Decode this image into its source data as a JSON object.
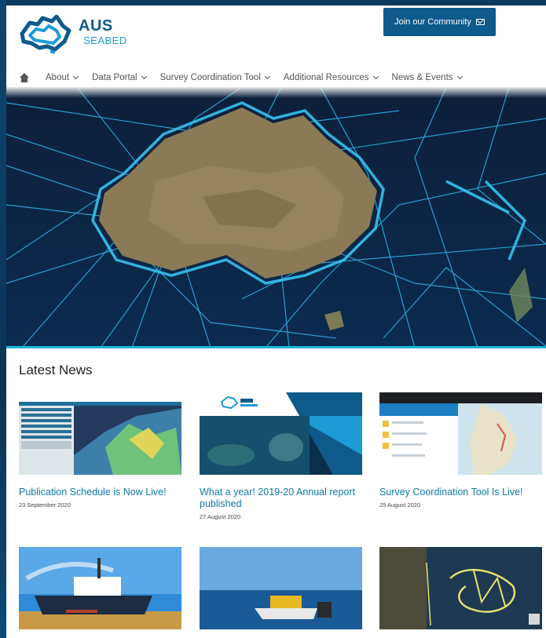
{
  "brand": {
    "name_line1": "AUS",
    "name_line2": "SEABED"
  },
  "header": {
    "join_button": "Join our Community"
  },
  "nav": {
    "items": [
      "About",
      "Data Portal",
      "Survey Coordination Tool",
      "Additional Resources",
      "News & Events"
    ]
  },
  "news": {
    "heading": "Latest News",
    "cards": [
      {
        "title": "Publication Schedule is Now Live!",
        "date": "23 September 2020"
      },
      {
        "title": "What a year! 2019-20 Annual report published",
        "date": "27 August 2020"
      },
      {
        "title": "Survey Coordination Tool Is Live!",
        "date": "25 August 2020"
      }
    ]
  },
  "colors": {
    "brand_dark": "#0e5a8a",
    "brand_light": "#1c9bd6",
    "accent_cyan": "#1fb4e0"
  }
}
